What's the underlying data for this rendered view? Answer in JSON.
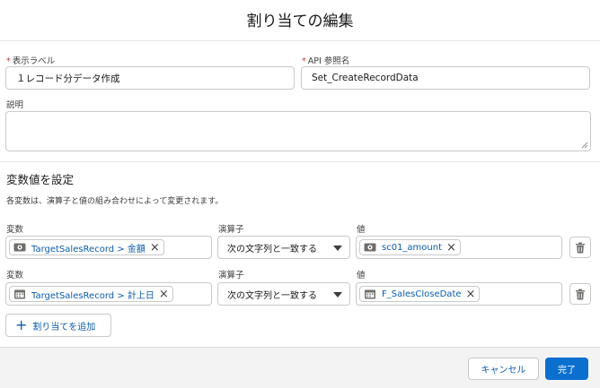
{
  "dialog": {
    "title": "割り当ての編集"
  },
  "form": {
    "display_label": {
      "label": "表示ラベル",
      "required_mark": "*",
      "value": "１レコード分データ作成"
    },
    "api_name": {
      "label": "API 参照名",
      "required_mark": "*",
      "value": "Set_CreateRecordData"
    },
    "description": {
      "label": "説明",
      "value": ""
    }
  },
  "variables_section": {
    "title": "変数値を設定",
    "description": "各変数は、演算子と値の組み合わせによって変更されます。",
    "col_variable": "変数",
    "col_operator": "演算子",
    "col_value": "値",
    "rows": [
      {
        "variable": {
          "icon": "currency-icon",
          "text": "TargetSalesRecord > 金額"
        },
        "operator": "次の文字列と一致する",
        "value": {
          "icon": "currency-icon",
          "text": "sc01_amount"
        }
      },
      {
        "variable": {
          "icon": "calendar-icon",
          "text": "TargetSalesRecord > 計上日"
        },
        "operator": "次の文字列と一致する",
        "value": {
          "icon": "calendar-icon",
          "text": "F_SalesCloseDate"
        }
      }
    ],
    "add_button": "割り当てを追加",
    "remove_icon": "×"
  },
  "footer": {
    "cancel": "キャンセル",
    "done": "完了"
  },
  "colors": {
    "link": "#0b5cab",
    "brand": "#0b6fce",
    "required": "#c23934"
  }
}
